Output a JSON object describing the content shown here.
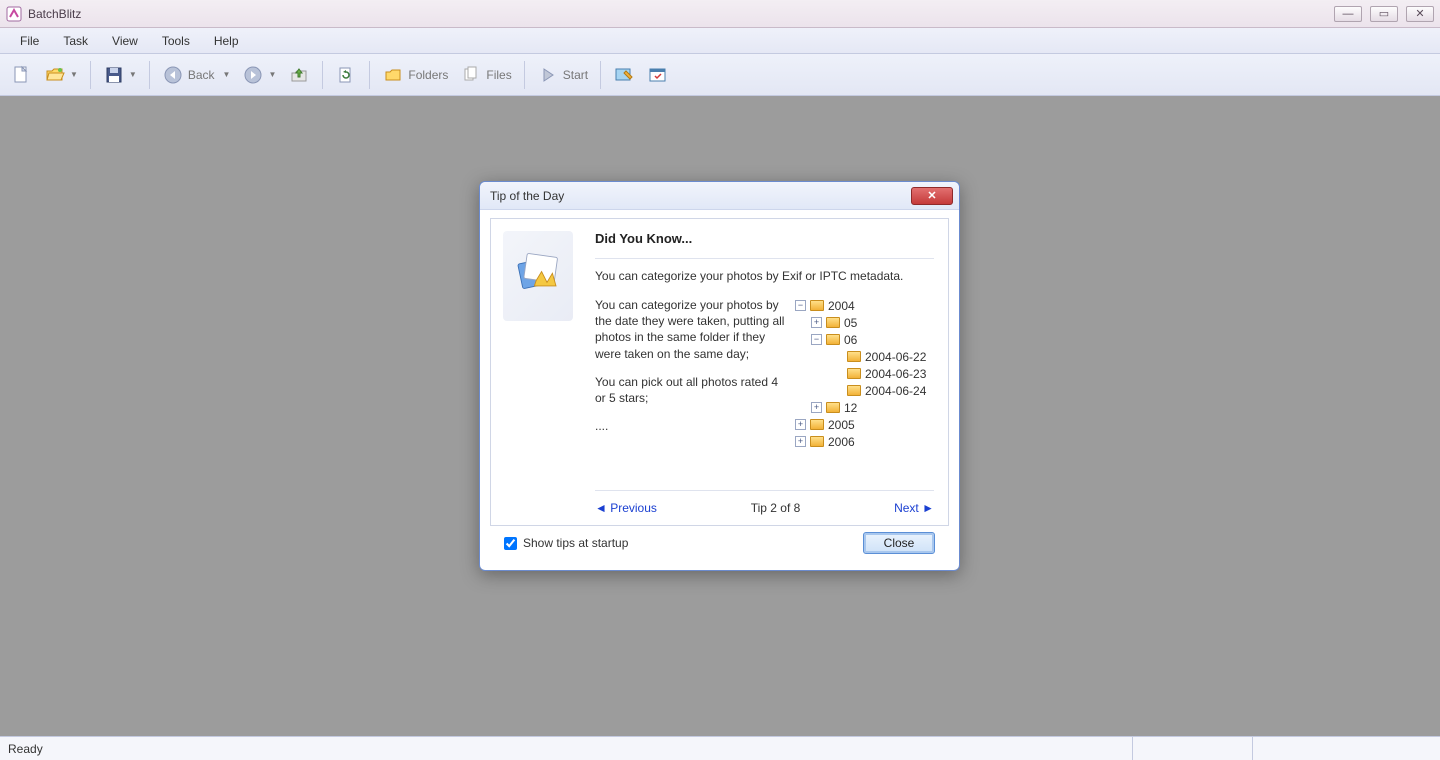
{
  "window": {
    "title": "BatchBlitz"
  },
  "menubar": {
    "file": "File",
    "task": "Task",
    "view": "View",
    "tools": "Tools",
    "help": "Help"
  },
  "toolbar": {
    "back_label": "Back",
    "folders_label": "Folders",
    "files_label": "Files",
    "start_label": "Start"
  },
  "statusbar": {
    "text": "Ready"
  },
  "dialog": {
    "title": "Tip of the Day",
    "heading": "Did You Know...",
    "intro": "You can categorize your photos by Exif or IPTC metadata.",
    "para1": "You can categorize your photos by the date they were taken, putting all photos in the same folder if they were taken on the same day;",
    "para2": "You can pick out all photos rated 4 or 5 stars;",
    "para3": "....",
    "prev": "◄ Previous",
    "page": "Tip 2 of 8",
    "next": "Next ►",
    "show_tips": "Show tips at startup",
    "close": "Close",
    "tree": {
      "y2004": "2004",
      "m05": "05",
      "m06": "06",
      "d1": "2004-06-22",
      "d2": "2004-06-23",
      "d3": "2004-06-24",
      "m12": "12",
      "y2005": "2005",
      "y2006": "2006"
    }
  }
}
